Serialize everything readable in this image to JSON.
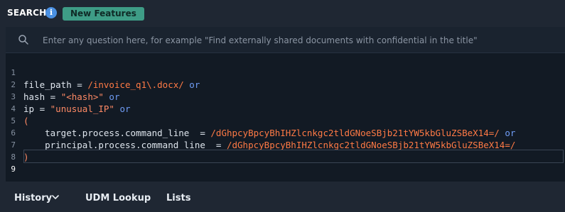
{
  "header": {
    "title": "SEARCH",
    "info_icon": "i",
    "badge": "New Features",
    "badge_color": "#3e9c86"
  },
  "search": {
    "placeholder": "Enter any question here, for example \"Find externally shared documents with confidential in the title\"",
    "value": ""
  },
  "editor": {
    "line_numbers": [
      "1",
      "2",
      "3",
      "4",
      "5",
      "6",
      "7",
      "8",
      "9"
    ],
    "lines": [
      {
        "indent": "",
        "field": "file_path = ",
        "value": "/invoice_q1\\.docx/",
        "op": " or"
      },
      {
        "indent": "",
        "field": "hash = ",
        "value": "\"<hash>\"",
        "op": " or"
      },
      {
        "indent": "",
        "field": "ip = ",
        "value": "\"unusual_IP\"",
        "op": " or"
      },
      {
        "indent": "",
        "field": "(",
        "value": "",
        "op": ""
      },
      {
        "indent": "    ",
        "field": "target.process.command_line  = ",
        "value": "/dGhpcyBpcyBhIHZlcnkgc2tldGNoeSBjb21tYW5kbGluZSBeX14=/",
        "op": " or"
      },
      {
        "indent": "    ",
        "field": "principal.process.command_line  = ",
        "value": "/dGhpcyBpcyBhIHZlcnkgc2tldGNoeSBjb21tYW5kbGluZSBeX14=/",
        "op": ""
      },
      {
        "indent": "",
        "field": ")",
        "value": "",
        "op": ""
      },
      {
        "indent": "",
        "field": "",
        "value": "",
        "op": ""
      },
      {
        "indent": "",
        "field": "",
        "value": "",
        "op": ""
      }
    ]
  },
  "tabs": {
    "history": "History",
    "udm_lookup": "UDM Lookup",
    "lists": "Lists"
  },
  "colors": {
    "keyword": "#6f9cf5",
    "string": "#ff8a65",
    "regex": "#ff7a45",
    "background": "#121a24"
  }
}
